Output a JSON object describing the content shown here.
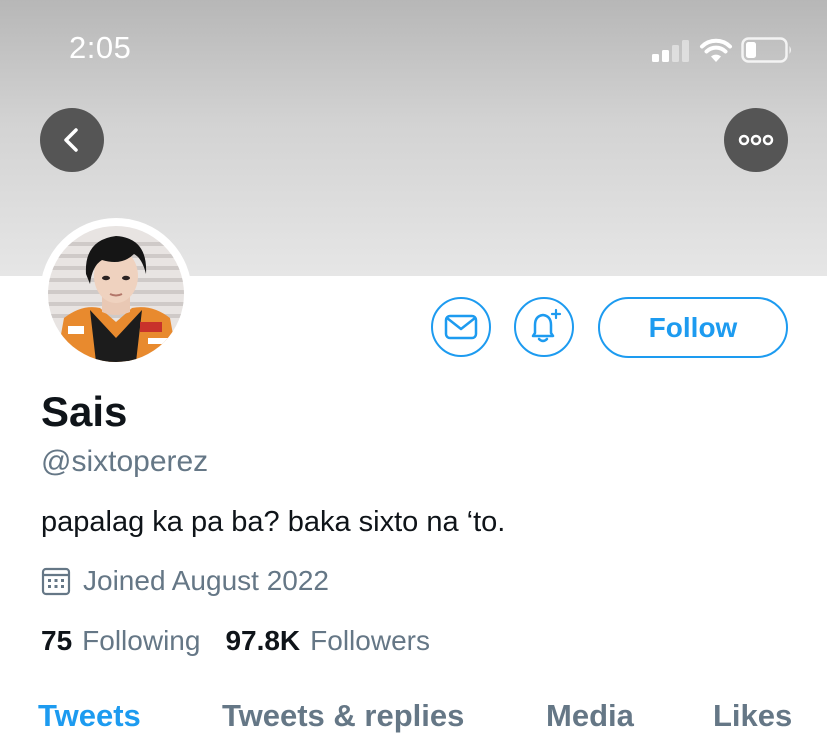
{
  "status_bar": {
    "time": "2:05",
    "signal_icon": "cellular-signal-icon",
    "wifi_icon": "wifi-icon",
    "battery_icon": "battery-icon"
  },
  "header": {
    "back_icon": "chevron-left-icon",
    "more_icon": "ellipsis-icon"
  },
  "profile": {
    "name": "Sais",
    "handle": "@sixtoperez",
    "bio": "papalag ka pa ba? baka sixto na ‘to.",
    "joined": "Joined August 2022",
    "stats": {
      "following_count": "75",
      "following_label": "Following",
      "followers_count": "97.8K",
      "followers_label": "Followers"
    }
  },
  "actions": {
    "follow_label": "Follow",
    "message_icon": "envelope-icon",
    "notify_icon": "bell-plus-icon"
  },
  "tabs": [
    {
      "label": "Tweets",
      "active": true
    },
    {
      "label": "Tweets & replies",
      "active": false
    },
    {
      "label": "Media",
      "active": false
    },
    {
      "label": "Likes",
      "active": false
    }
  ],
  "colors": {
    "accent": "#1d9bf0",
    "secondary_text": "#657786",
    "primary_text": "#0f1419",
    "header_button": "#555555"
  }
}
